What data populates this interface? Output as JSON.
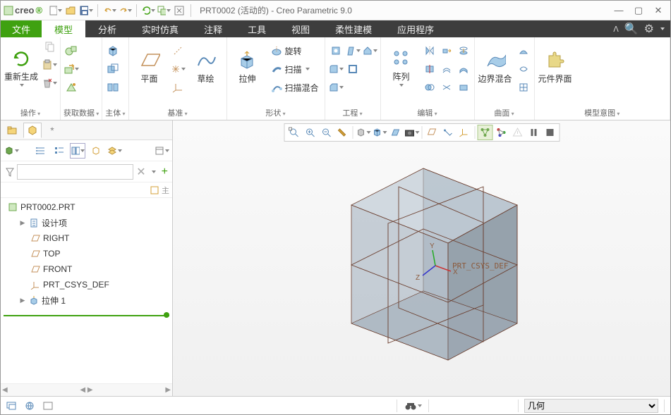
{
  "app": {
    "brand": "creo",
    "title": "PRT0002 (活动的) - Creo Parametric 9.0"
  },
  "menu": {
    "file": "文件",
    "tabs": [
      "模型",
      "分析",
      "实时仿真",
      "注释",
      "工具",
      "视图",
      "柔性建模",
      "应用程序"
    ],
    "active_index": 0
  },
  "ribbon": {
    "groups": {
      "ops": {
        "label": "操作",
        "regen": "重新生成"
      },
      "getdata": {
        "label": "获取数据"
      },
      "body": {
        "label": "主体"
      },
      "datum": {
        "label": "基准",
        "plane": "平面",
        "sketch": "草绘"
      },
      "shape": {
        "label": "形状",
        "extrude": "拉伸",
        "revolve": "旋转",
        "sweep": "扫描",
        "swept_blend": "扫描混合"
      },
      "eng": {
        "label": "工程"
      },
      "edit": {
        "label": "编辑",
        "pattern": "阵列"
      },
      "surface": {
        "label": "曲面",
        "boundary": "边界混合"
      },
      "intent": {
        "label": "模型意图",
        "compui": "元件界面"
      }
    }
  },
  "tree": {
    "root": "PRT0002.PRT",
    "nodes": {
      "design_items": "设计项",
      "right": "RIGHT",
      "top": "TOP",
      "front": "FRONT",
      "csys": "PRT_CSYS_DEF",
      "extrude1": "拉伸 1"
    },
    "favorites_tab": "*",
    "handle_label": "主"
  },
  "gfx": {
    "csys_label": "PRT_CSYS_DEF",
    "axes": {
      "x": "X",
      "y": "Y",
      "z": "Z"
    }
  },
  "status": {
    "filter_options": [
      "几何"
    ],
    "filter_selected": "几何"
  }
}
